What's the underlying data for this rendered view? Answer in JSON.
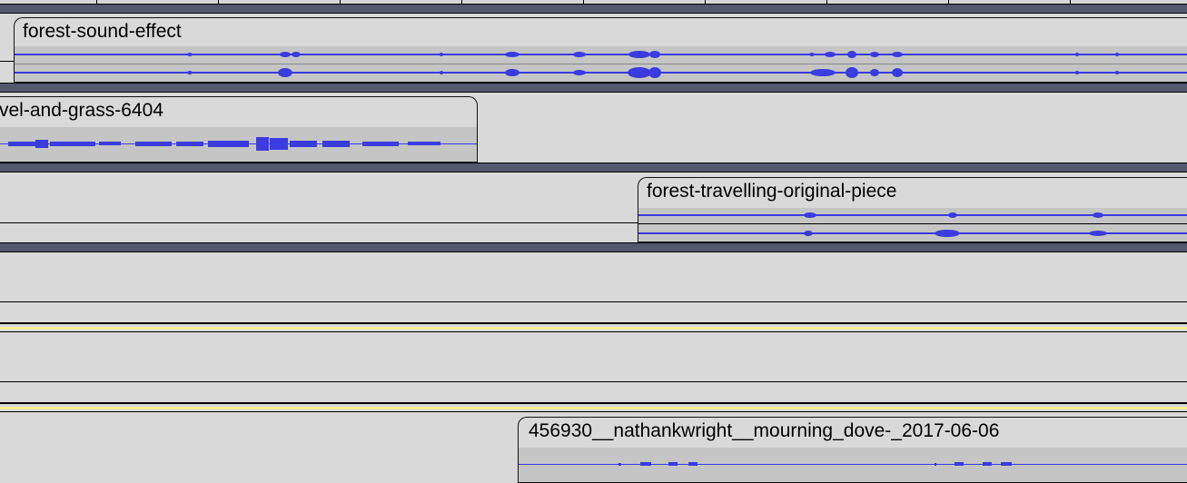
{
  "tracks": [
    {
      "clip_name": "forest-sound-effect",
      "channels": "stereo",
      "wave_color": "#3b3be0"
    },
    {
      "clip_name": "vel-and-grass-6404",
      "channels": "mono",
      "wave_color": "#3b3be0"
    },
    {
      "clip_name": "forest-travelling-original-piece",
      "channels": "stereo",
      "wave_color": "#3b3be0"
    },
    {
      "clip_name": "456930__nathankwright__mourning_dove-_2017-06-06",
      "channels": "mono",
      "wave_color": "#3b3be0"
    }
  ],
  "colors": {
    "track_background": "#d9d9d9",
    "separator": "#53586a",
    "selection_highlight": "#f4ee9a",
    "waveform": "#3b3be0"
  }
}
